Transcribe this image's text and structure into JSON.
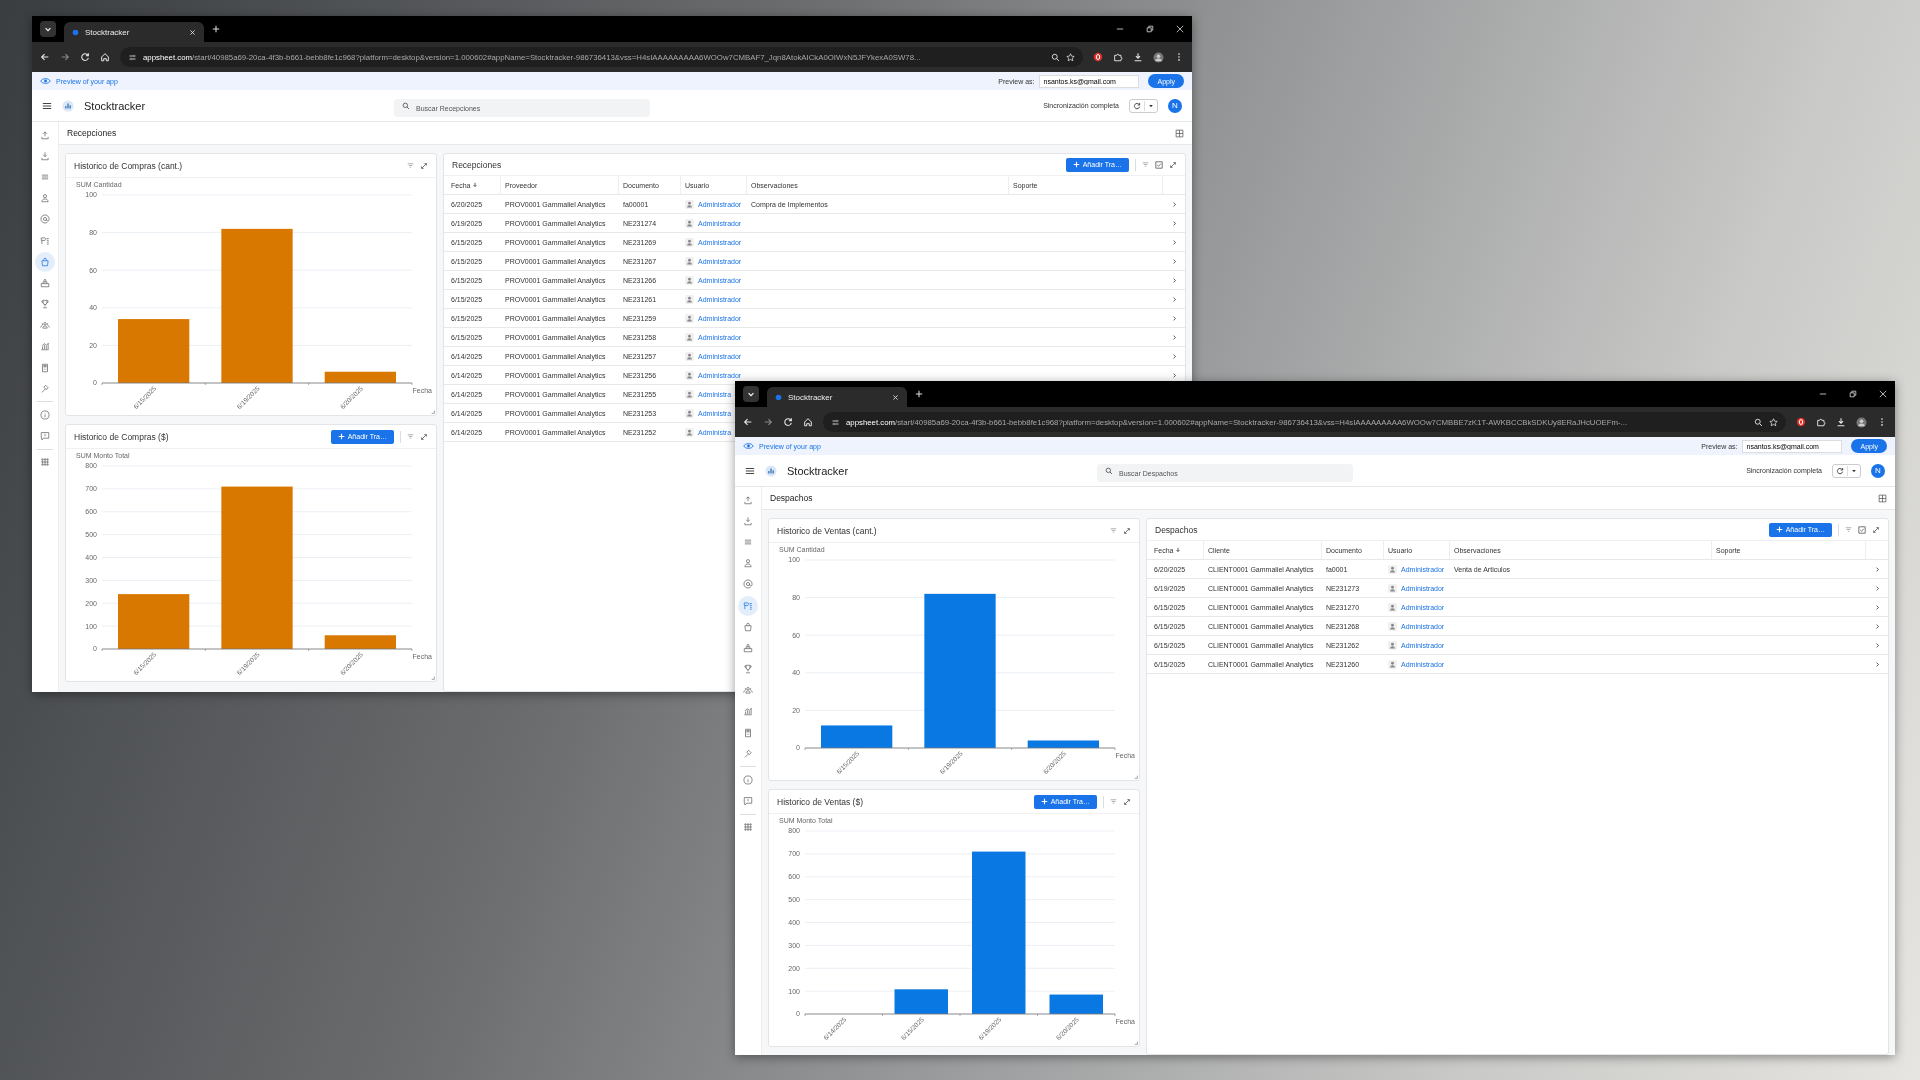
{
  "windows": [
    {
      "tab_title": "Stocktracker",
      "url_host": "appsheet.com",
      "url_path": "/start/40985a69-20ca-4f3b-b661-bebb8fe1c968?platform=desktop&version=1.000602#appName=Stocktracker-986736413&vss=H4sIAAAAAAAAA6WOOw7CMBAF7_Jqn8AtokAICkA0OIWxN5JFYkexA0SW78...",
      "preview_label": "Preview of your app",
      "preview_as_label": "Preview as:",
      "preview_email": "nsantos.ks@gmail.com",
      "apply_button": "Apply",
      "app_title": "Stocktracker",
      "search_placeholder": "Buscar Recepciones",
      "sync_status": "Sincronización completa",
      "avatar_letter": "N",
      "view_title": "Recepciones",
      "sidebar": [
        {
          "items": [
            {
              "kind": "upload-tray",
              "selected": false
            },
            {
              "kind": "download-tray",
              "selected": false
            },
            {
              "kind": "lines",
              "selected": false
            },
            {
              "kind": "person",
              "selected": false
            },
            {
              "kind": "at-sign",
              "selected": false
            },
            {
              "kind": "tag-list",
              "selected": false
            },
            {
              "kind": "shopping-bag",
              "selected": true
            },
            {
              "kind": "inbox-tray",
              "selected": false
            },
            {
              "kind": "trophy",
              "selected": false
            },
            {
              "kind": "people",
              "selected": false
            },
            {
              "kind": "bar-chart",
              "selected": false
            },
            {
              "kind": "calculator",
              "selected": false
            },
            {
              "kind": "hammer",
              "selected": false
            }
          ]
        },
        {
          "items": [
            {
              "kind": "info",
              "selected": false
            },
            {
              "kind": "feedback",
              "selected": false
            }
          ]
        },
        {
          "items": [
            {
              "kind": "apps",
              "selected": false
            }
          ]
        }
      ],
      "charts": [
        {
          "title": "Historico de Compras (cant.)",
          "chart_data": {
            "type": "bar",
            "ylabel": "SUM Cantidad",
            "xlabel": "Fecha",
            "grid": true,
            "categories": [
              "6/15/2025",
              "6/19/2025",
              "6/20/2025"
            ],
            "series": [
              {
                "color": "#d97800",
                "values": [
                  34,
                  82,
                  6
                ]
              }
            ],
            "ylim": [
              0,
              100
            ],
            "yticks": [
              0,
              20,
              40,
              60,
              80,
              100
            ]
          }
        },
        {
          "title": "Historico de Compras ($)",
          "add_button": "Añadir Tra…",
          "chart_data": {
            "type": "bar",
            "ylabel": "SUM Monto Total",
            "xlabel": "Fecha",
            "grid": true,
            "categories": [
              "6/15/2025",
              "6/19/2025",
              "6/20/2025"
            ],
            "series": [
              {
                "color": "#d97800",
                "values": [
                  240,
                  710,
                  60
                ]
              }
            ],
            "ylim": [
              0,
              800
            ],
            "yticks": [
              0,
              100,
              200,
              300,
              400,
              500,
              600,
              700,
              800
            ]
          }
        }
      ],
      "table": {
        "title": "Recepciones",
        "add_button": "Añadir Tra…",
        "columns": [
          {
            "label": "Fecha",
            "sorted_desc": true
          },
          {
            "label": "Proveedor",
            "sorted_desc": false
          },
          {
            "label": "Documento",
            "sorted_desc": false
          },
          {
            "label": "Usuario",
            "sorted_desc": false
          },
          {
            "label": "Observaciones",
            "sorted_desc": false
          },
          {
            "label": "Soporte",
            "sorted_desc": false
          }
        ],
        "rows": [
          {
            "fecha": "6/20/2025",
            "party": "PROV0001 Gammaliel Analytics",
            "documento": "fa00001",
            "usuario": "Administrador",
            "observaciones": "Compra de Implementos"
          },
          {
            "fecha": "6/19/2025",
            "party": "PROV0001 Gammaliel Analytics",
            "documento": "NE231274",
            "usuario": "Administrador"
          },
          {
            "fecha": "6/15/2025",
            "party": "PROV0001 Gammaliel Analytics",
            "documento": "NE231269",
            "usuario": "Administrador"
          },
          {
            "fecha": "6/15/2025",
            "party": "PROV0001 Gammaliel Analytics",
            "documento": "NE231267",
            "usuario": "Administrador"
          },
          {
            "fecha": "6/15/2025",
            "party": "PROV0001 Gammaliel Analytics",
            "documento": "NE231266",
            "usuario": "Administrador"
          },
          {
            "fecha": "6/15/2025",
            "party": "PROV0001 Gammaliel Analytics",
            "documento": "NE231261",
            "usuario": "Administrador"
          },
          {
            "fecha": "6/15/2025",
            "party": "PROV0001 Gammaliel Analytics",
            "documento": "NE231259",
            "usuario": "Administrador"
          },
          {
            "fecha": "6/15/2025",
            "party": "PROV0001 Gammaliel Analytics",
            "documento": "NE231258",
            "usuario": "Administrador"
          },
          {
            "fecha": "6/14/2025",
            "party": "PROV0001 Gammaliel Analytics",
            "documento": "NE231257",
            "usuario": "Administrador"
          },
          {
            "fecha": "6/14/2025",
            "party": "PROV0001 Gammaliel Analytics",
            "documento": "NE231256",
            "usuario": "Administrador"
          },
          {
            "fecha": "6/14/2025",
            "party": "PROV0001 Gammaliel Analytics",
            "documento": "NE231255",
            "usuario": "Administra"
          },
          {
            "fecha": "6/14/2025",
            "party": "PROV0001 Gammaliel Analytics",
            "documento": "NE231253",
            "usuario": "Administra"
          },
          {
            "fecha": "6/14/2025",
            "party": "PROV0001 Gammaliel Analytics",
            "documento": "NE231252",
            "usuario": "Administra"
          }
        ]
      }
    },
    {
      "tab_title": "Stocktracker",
      "url_host": "appsheet.com",
      "url_path": "/start/40985a69-20ca-4f3b-b661-bebb8fe1c968?platform=desktop&version=1.000602#appName=Stocktracker-986736413&vss=H4sIAAAAAAAAA6WOOw7CMBBE7zK1T-AWKBCCBkSDKUy8ERaJHcUOEFm-...",
      "preview_label": "Preview of your app",
      "preview_as_label": "Preview as:",
      "preview_email": "nsantos.ks@gmail.com",
      "apply_button": "Apply",
      "app_title": "Stocktracker",
      "search_placeholder": "Buscar Despachos",
      "sync_status": "Sincronización completa",
      "avatar_letter": "N",
      "view_title": "Despachos",
      "sidebar": [
        {
          "items": [
            {
              "kind": "upload-tray",
              "selected": false
            },
            {
              "kind": "download-tray",
              "selected": false
            },
            {
              "kind": "lines",
              "selected": false
            },
            {
              "kind": "person",
              "selected": false
            },
            {
              "kind": "at-sign",
              "selected": false
            },
            {
              "kind": "tag-list",
              "selected": true
            },
            {
              "kind": "shopping-bag",
              "selected": false
            },
            {
              "kind": "inbox-tray",
              "selected": false
            },
            {
              "kind": "trophy",
              "selected": false
            },
            {
              "kind": "people",
              "selected": false
            },
            {
              "kind": "bar-chart",
              "selected": false
            },
            {
              "kind": "calculator",
              "selected": false
            },
            {
              "kind": "hammer",
              "selected": false
            }
          ]
        },
        {
          "items": [
            {
              "kind": "info",
              "selected": false
            },
            {
              "kind": "feedback",
              "selected": false
            }
          ]
        },
        {
          "items": [
            {
              "kind": "apps",
              "selected": false
            }
          ]
        }
      ],
      "charts": [
        {
          "title": "Historico de Ventas (cant.)",
          "chart_data": {
            "type": "bar",
            "ylabel": "SUM Cantidad",
            "xlabel": "Fecha",
            "grid": true,
            "categories": [
              "6/15/2025",
              "6/19/2025",
              "6/20/2025"
            ],
            "series": [
              {
                "color": "#0a78e2",
                "values": [
                  12,
                  82,
                  4
                ]
              }
            ],
            "ylim": [
              0,
              100
            ],
            "yticks": [
              0,
              20,
              40,
              60,
              80,
              100
            ]
          }
        },
        {
          "title": "Historico de Ventas ($)",
          "add_button": "Añadir Tra…",
          "chart_data": {
            "type": "bar",
            "ylabel": "SUM Monto Total",
            "xlabel": "Fecha",
            "grid": true,
            "categories": [
              "6/14/2025",
              "6/15/2025",
              "6/19/2025",
              "6/20/2025"
            ],
            "series": [
              {
                "color": "#0a78e2",
                "values": [
                  0,
                  108,
                  710,
                  85
                ]
              }
            ],
            "ylim": [
              0,
              800
            ],
            "yticks": [
              0,
              100,
              200,
              300,
              400,
              500,
              600,
              700,
              800
            ]
          }
        }
      ],
      "table": {
        "title": "Despachos",
        "add_button": "Añadir Tra…",
        "columns": [
          {
            "label": "Fecha",
            "sorted_desc": true
          },
          {
            "label": "Cliente",
            "sorted_desc": false
          },
          {
            "label": "Documento",
            "sorted_desc": false
          },
          {
            "label": "Usuario",
            "sorted_desc": false
          },
          {
            "label": "Observaciones",
            "sorted_desc": false
          },
          {
            "label": "Soporte",
            "sorted_desc": false
          }
        ],
        "rows": [
          {
            "fecha": "6/20/2025",
            "party": "CLIENT0001 Gammaliel Analytics",
            "documento": "fa0001",
            "usuario": "Administrador",
            "observaciones": "Venta de Articulos"
          },
          {
            "fecha": "6/19/2025",
            "party": "CLIENT0001 Gammaliel Analytics",
            "documento": "NE231273",
            "usuario": "Administrador"
          },
          {
            "fecha": "6/15/2025",
            "party": "CLIENT0001 Gammaliel Analytics",
            "documento": "NE231270",
            "usuario": "Administrador"
          },
          {
            "fecha": "6/15/2025",
            "party": "CLIENT0001 Gammaliel Analytics",
            "documento": "NE231268",
            "usuario": "Administrador"
          },
          {
            "fecha": "6/15/2025",
            "party": "CLIENT0001 Gammaliel Analytics",
            "documento": "NE231262",
            "usuario": "Administrador"
          },
          {
            "fecha": "6/15/2025",
            "party": "CLIENT0001 Gammaliel Analytics",
            "documento": "NE231260",
            "usuario": "Administrador"
          }
        ]
      }
    }
  ]
}
